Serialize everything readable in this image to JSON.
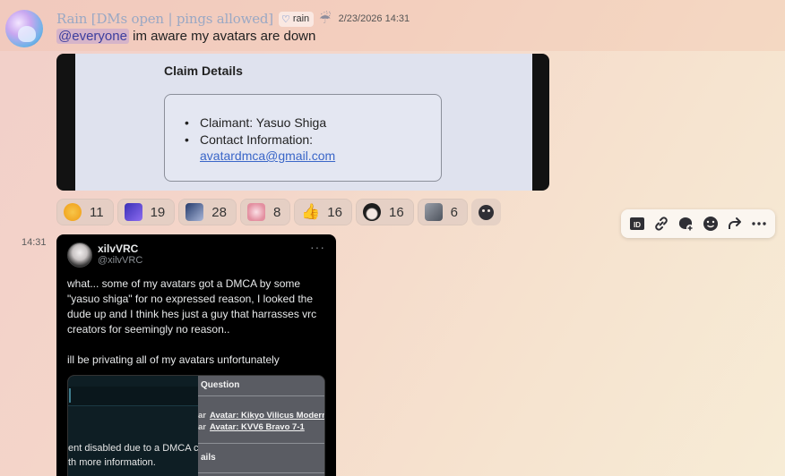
{
  "message": {
    "username": "Rain [DMs open | pings allowed]",
    "role_tag": "rain",
    "role_icon": "heart-icon",
    "status_icon": "cloud-rain-icon",
    "timestamp": "2/23/2026 14:31",
    "mention": "@everyone",
    "text": " im aware my avatars are down"
  },
  "claim_embed": {
    "title": "Claim Details",
    "items": [
      "Claimant: Yasuo Shiga",
      "Contact Information:"
    ],
    "email": "avatardmca@gmail.com"
  },
  "reactions": [
    {
      "icon": "kiss-face-emoji",
      "count": "11",
      "color": "#f2b632"
    },
    {
      "icon": "anime-face-emoji",
      "count": "19",
      "color": "#5a4bd8"
    },
    {
      "icon": "avatar-figure-emoji",
      "count": "28",
      "color": "#4d6ab0"
    },
    {
      "icon": "pink-character-emoji",
      "count": "8",
      "color": "#e59aa8"
    },
    {
      "icon": "thumbs-up-emoji",
      "count": "16",
      "color": "#f5b83a"
    },
    {
      "icon": "black-hair-girl-emoji",
      "count": "16",
      "color": "#2c2c2c"
    },
    {
      "icon": "dog-emoji",
      "count": "6",
      "color": "#7b7f8a"
    }
  ],
  "toolbar": [
    "id-icon",
    "link-icon",
    "thread-icon",
    "add-reaction-icon",
    "forward-icon",
    "more-icon"
  ],
  "second_message": {
    "timestamp": "14:31"
  },
  "tweet": {
    "name": "xilvVRC",
    "handle": "@xilvVRC",
    "more": "···",
    "paragraph1": "what... some of my avatars got a DMCA by some \"yasuo shiga\" for no expressed reason, I looked the dude up and I think hes just a guy that harrasses vrc creators for seemingly no reason..",
    "paragraph2": "ill be privating all of my avatars unfortunately",
    "media": {
      "question_label": "Question",
      "row1_prefix": "ar",
      "row1_link": "Avatar: Kikyo Vilicus Modern",
      "row2_prefix": "ar",
      "row2_link": "Avatar: KVV6 Bravo 7-1",
      "section_label": "ails",
      "notice_line1": "ent disabled due to a DMCA cla",
      "notice_line2": "th more information."
    }
  }
}
